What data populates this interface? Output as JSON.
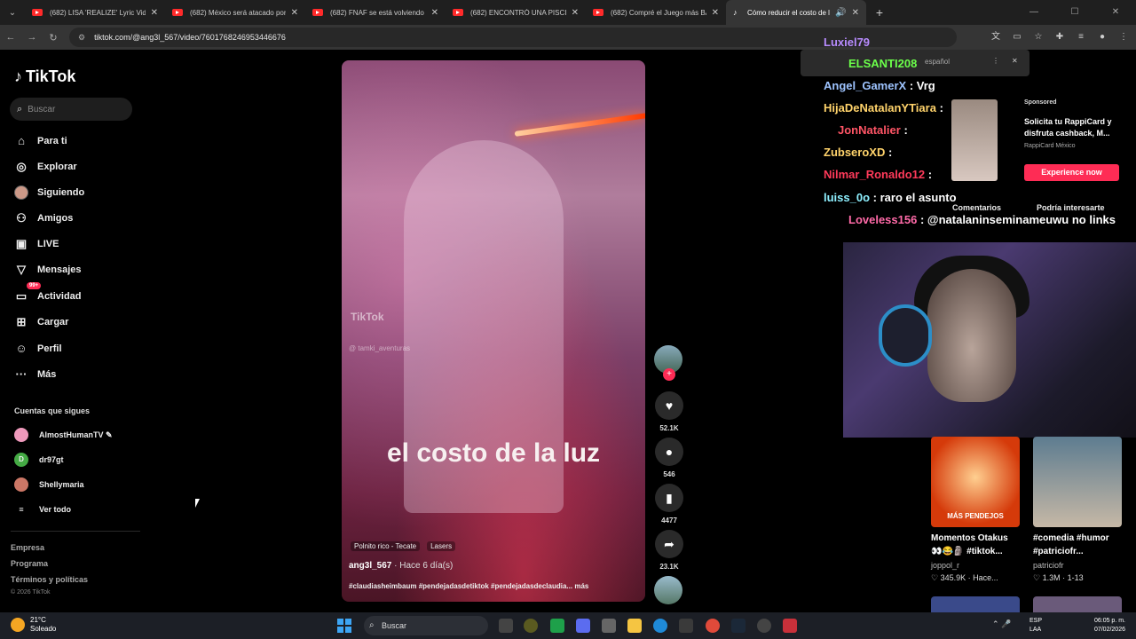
{
  "browser": {
    "tabs": [
      {
        "title": "(682) LISA 'REALIZE' Lyric Video",
        "active": false,
        "favicon": "youtube-icon"
      },
      {
        "title": "(682) México será atacado por",
        "active": false,
        "favicon": "youtube-icon"
      },
      {
        "title": "(682) FNAF se está volviendo B",
        "active": false,
        "favicon": "youtube-icon"
      },
      {
        "title": "(682) ENCONTRÓ UNA PISCINA",
        "active": false,
        "favicon": "youtube-icon"
      },
      {
        "title": "(682) Compré el Juego más BAR",
        "active": false,
        "favicon": "youtube-icon"
      },
      {
        "title": "Cómo reducir el costo de la",
        "active": true,
        "favicon": "tiktok-icon"
      }
    ],
    "url": "tiktok.com/@ang3l_567/video/7601768246953446676"
  },
  "sidebar": {
    "logo": "TikTok",
    "search_placeholder": "Buscar",
    "nav": [
      {
        "label": "Para ti",
        "icon": "home-icon"
      },
      {
        "label": "Explorar",
        "icon": "compass-icon"
      },
      {
        "label": "Siguiendo",
        "icon": "avatar-icon"
      },
      {
        "label": "Amigos",
        "icon": "friends-icon"
      },
      {
        "label": "LIVE",
        "icon": "live-icon"
      },
      {
        "label": "Mensajes",
        "icon": "send-icon"
      },
      {
        "label": "Actividad",
        "icon": "inbox-icon",
        "badge": "99+"
      },
      {
        "label": "Cargar",
        "icon": "plus-square-icon"
      },
      {
        "label": "Perfil",
        "icon": "profile-icon"
      },
      {
        "label": "Más",
        "icon": "more-icon"
      }
    ],
    "following_title": "Cuentas que sigues",
    "following": [
      {
        "name": "AlmostHumanTV",
        "verified_mark": "✎"
      },
      {
        "name": "dr97gt",
        "initial": "D"
      },
      {
        "name": "Shellymaria"
      }
    ],
    "see_all": "Ver todo",
    "footer": [
      "Empresa",
      "Programa",
      "Términos y políticas"
    ],
    "copyright": "© 2026 TikTok"
  },
  "video": {
    "watermark": "TikTok",
    "watermark_user": "@ tamki_aventuras",
    "caption": "el costo de la luz",
    "tags": [
      "Polnito rico - Tecate",
      "Lasers"
    ],
    "author": "ang3l_567",
    "posted": " · Hace 6 día(s)",
    "description": "#claudiasheimbaum #pendejadasdetiktok #pendejadasdeclaudia...",
    "more": "más",
    "likes": "52.1K",
    "comments": "546",
    "saves": "4477",
    "shares": "23.1K"
  },
  "chat": {
    "popup_text": "español",
    "lines": [
      {
        "user": "Luxiel79",
        "msg": "",
        "color": "#b88cff"
      },
      {
        "user": "ELSANTI208",
        "msg": "",
        "color": "#6bff4a"
      },
      {
        "user": "Angel_GamerX",
        "msg": ": Vrg",
        "color": "#9ec4ff"
      },
      {
        "user": "HijaDeNatalanYTiara",
        "msg": ":",
        "color": "#ffd36b"
      },
      {
        "user": "JonNatalier",
        "msg": ":",
        "color": "#ff5566"
      },
      {
        "user": "ZubseroXD",
        "msg": ":",
        "color": "#ffd36b"
      },
      {
        "user": "Nilmar_Ronaldo12",
        "msg": ":",
        "color": "#ff3a5a"
      },
      {
        "user": "luiss_0o",
        "msg": ": raro el asunto",
        "color": "#8ef0ff"
      },
      {
        "user": "Loveless156",
        "msg": ": @natalaninseminameuwu no links",
        "color": "#ff6aa8"
      }
    ]
  },
  "ad": {
    "label": "Sponsored",
    "title": "Solicita tu RappiCard y disfruta cashback, M...",
    "advertiser": "RappiCard México",
    "cta": "Experience now"
  },
  "right_tabs": {
    "comments": "Comentarios",
    "related": "Podría interesarte"
  },
  "suggestions": [
    {
      "title": "Momentos Otakus",
      "subtitle": "#tiktok...",
      "user": "joppol_r",
      "stats": "♡ 345.9K · Hace...",
      "overlay": "MÁS PENDEJOS"
    },
    {
      "title": "#comedia #humor",
      "subtitle": "#patriciofr...",
      "user": "patriciofr",
      "stats": "♡ 1.3M · 1-13",
      "overlay": ""
    }
  ],
  "taskbar": {
    "temp": "21°C",
    "weather": "Soleado",
    "search": "Buscar",
    "lang1": "ESP",
    "lang2": "LAA",
    "time": "06:05 p. m.",
    "date": "07/02/2026"
  },
  "colors": {
    "accent": "#fe2c55",
    "background": "#000000"
  }
}
